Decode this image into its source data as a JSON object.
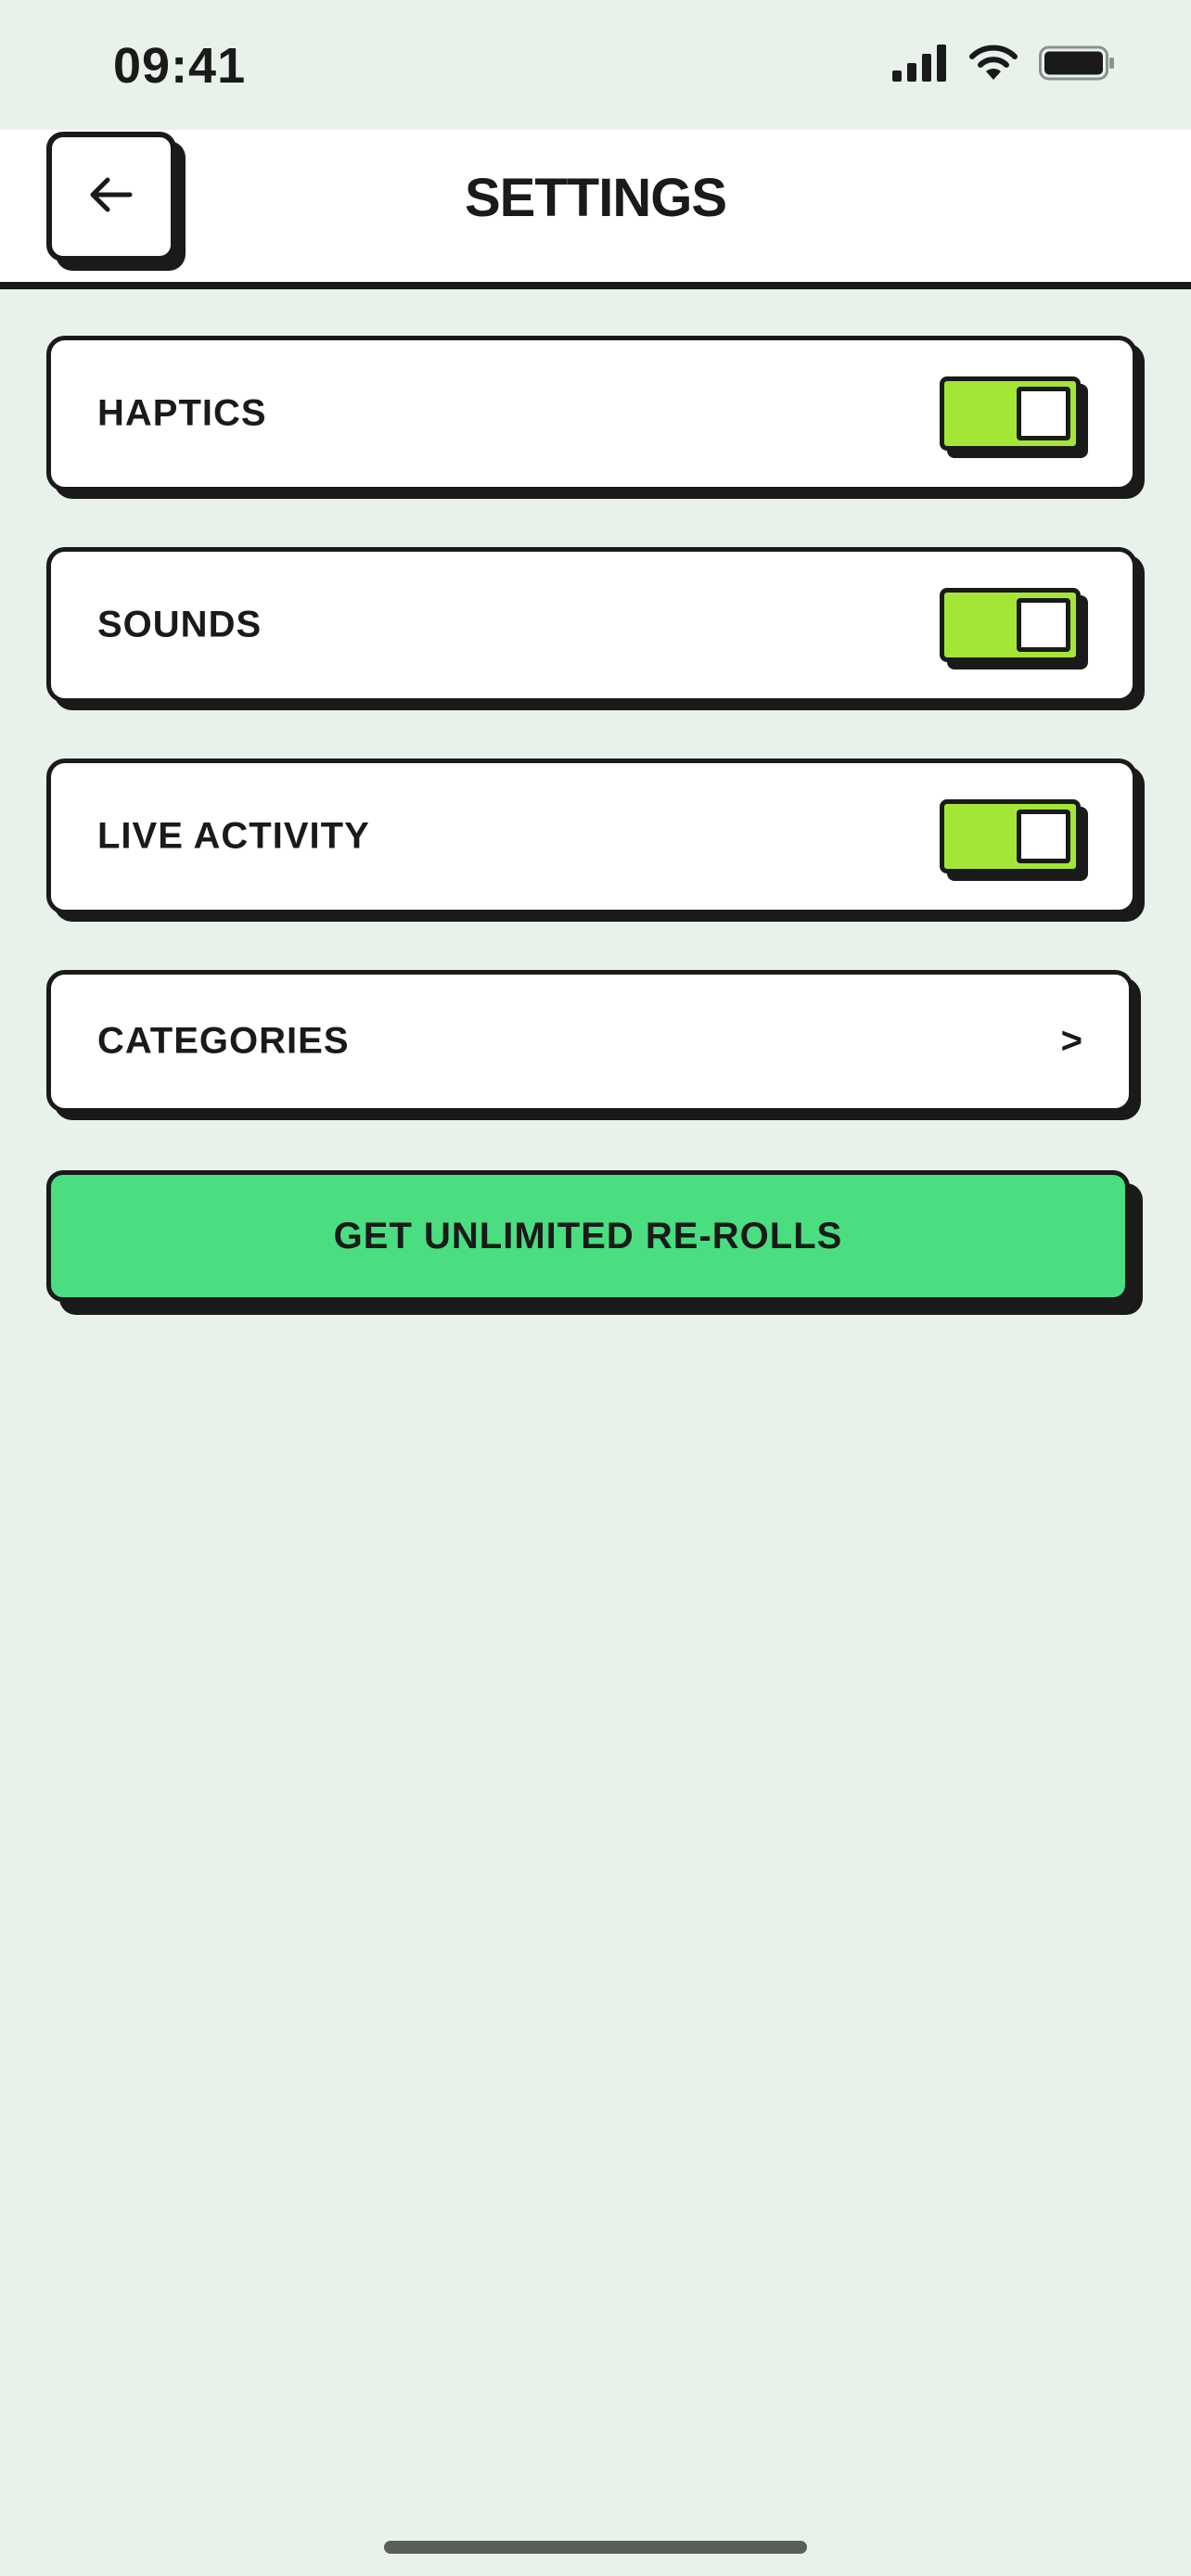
{
  "status_bar": {
    "time": "09:41",
    "icons": [
      "cellular-signal-icon",
      "wifi-icon",
      "battery-icon"
    ]
  },
  "header": {
    "title": "SETTINGS",
    "back_icon": "arrow-left-icon"
  },
  "settings": {
    "haptics": {
      "label": "HAPTICS",
      "enabled": true
    },
    "sounds": {
      "label": "SOUNDS",
      "enabled": true
    },
    "live_activity": {
      "label": "LIVE ACTIVITY",
      "enabled": true
    },
    "categories": {
      "label": "CATEGORIES",
      "chevron": ">"
    }
  },
  "cta": {
    "label": "GET UNLIMITED RE-ROLLS"
  },
  "colors": {
    "background": "#E8F2EB",
    "toggle_on": "#A3E635",
    "cta": "#4ADE80",
    "ink": "#1A1A1A"
  }
}
